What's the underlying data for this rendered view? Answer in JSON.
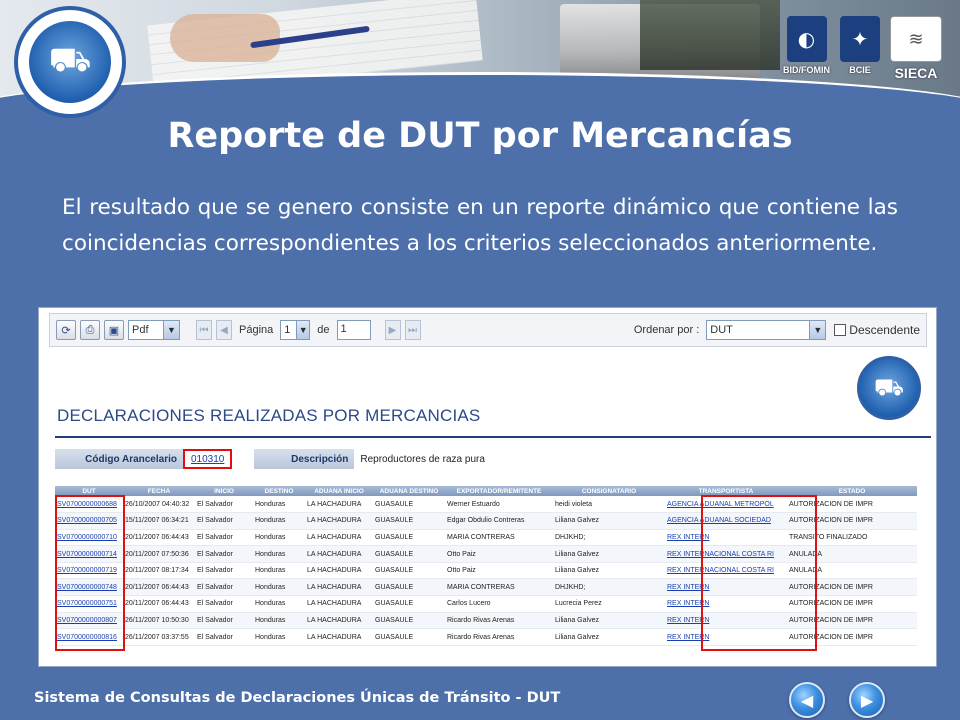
{
  "banner": {
    "partners": [
      {
        "label": "BID/FOMIN",
        "icon": "globe-icon"
      },
      {
        "label": "BCIE",
        "icon": "map-icon"
      },
      {
        "label": "SIECA",
        "icon": "sieca-icon"
      }
    ]
  },
  "slide": {
    "title": "Reporte de DUT por Mercancías",
    "intro": "El resultado que se genero consiste en un reporte dinámico que contiene las coincidencias correspondientes a los criterios seleccionados anteriormente."
  },
  "toolbar": {
    "format": "Pdf",
    "page_label": "Página",
    "page_value": "1",
    "of_label": "de",
    "page_total": "1",
    "order_label": "Ordenar por :",
    "order_value": "DUT",
    "descending_label": "Descendente"
  },
  "report": {
    "heading": "DECLARACIONES REALIZADAS POR MERCANCIAS",
    "tariff_label": "Código Arancelario",
    "tariff_value": "010310",
    "description_label": "Descripción",
    "description_value": "Reproductores de raza pura",
    "columns": [
      "DUT",
      "FECHA",
      "INICIO",
      "DESTINO",
      "ADUANA INICIO",
      "ADUANA DESTINO",
      "EXPORTADOR/REMITENTE",
      "CONSIGNATARIO",
      "TRANSPORTISTA",
      "ESTADO"
    ],
    "rows": [
      [
        "SV0700000000688",
        "26/10/2007 04:40:32",
        "El Salvador",
        "Honduras",
        "LA HACHADURA",
        "GUASAULE",
        "Werner Estuardo",
        "heidi violeta",
        "AGENCIA ADUANAL METROPOL",
        "AUTORIZACION DE IMPR"
      ],
      [
        "SV0700000000705",
        "15/11/2007 06:34:21",
        "El Salvador",
        "Honduras",
        "LA HACHADURA",
        "GUASAULE",
        "Edgar Obdulio Contreras",
        "Liliana Galvez",
        "AGENCIA ADUANAL SOCIEDAD",
        "AUTORIZACION DE IMPR"
      ],
      [
        "SV0700000000710",
        "20/11/2007 06:44:43",
        "El Salvador",
        "Honduras",
        "LA HACHADURA",
        "GUASAULE",
        "MARIA CONTRERAS",
        "DHJKHD;",
        "REX INTERN",
        "TRANSITO FINALIZADO"
      ],
      [
        "SV0700000000714",
        "20/11/2007 07:50:36",
        "El Salvador",
        "Honduras",
        "LA HACHADURA",
        "GUASAULE",
        "Otto Paiz",
        "Liliana Galvez",
        "REX INTERNACIONAL COSTA RI",
        "ANULADA"
      ],
      [
        "SV0700000000719",
        "20/11/2007 08:17:34",
        "El Salvador",
        "Honduras",
        "LA HACHADURA",
        "GUASAULE",
        "Otto Paiz",
        "Liliana Galvez",
        "REX INTERNACIONAL COSTA RI",
        "ANULADA"
      ],
      [
        "SV0700000000748",
        "20/11/2007 06:44:43",
        "El Salvador",
        "Honduras",
        "LA HACHADURA",
        "GUASAULE",
        "MARIA CONTRERAS",
        "DHJKHD;",
        "REX INTERN",
        "AUTORIZACION DE IMPR"
      ],
      [
        "SV0700000000751",
        "20/11/2007 06:44:43",
        "El Salvador",
        "Honduras",
        "LA HACHADURA",
        "GUASAULE",
        "Carlos Lucero",
        "Lucrecia Perez",
        "REX INTERN",
        "AUTORIZACION DE IMPR"
      ],
      [
        "SV0700000000807",
        "26/11/2007 10:50:30",
        "El Salvador",
        "Honduras",
        "LA HACHADURA",
        "GUASAULE",
        "Ricardo Rivas Arenas",
        "Liliana Galvez",
        "REX INTERN",
        "AUTORIZACION DE IMPR"
      ],
      [
        "SV0700000000816",
        "26/11/2007 03:37:55",
        "El Salvador",
        "Honduras",
        "LA HACHADURA",
        "GUASAULE",
        "Ricardo Rivas Arenas",
        "Liliana Galvez",
        "REX INTERN",
        "AUTORIZACION DE IMPR"
      ]
    ]
  },
  "footer": {
    "text": "Sistema de Consultas de Declaraciones Únicas de Tránsito - DUT",
    "prev_icon": "arrow-left-icon",
    "next_icon": "arrow-right-icon"
  },
  "colors": {
    "background": "#4d6faa",
    "link": "#1a3fb0",
    "highlight": "#e01010"
  }
}
